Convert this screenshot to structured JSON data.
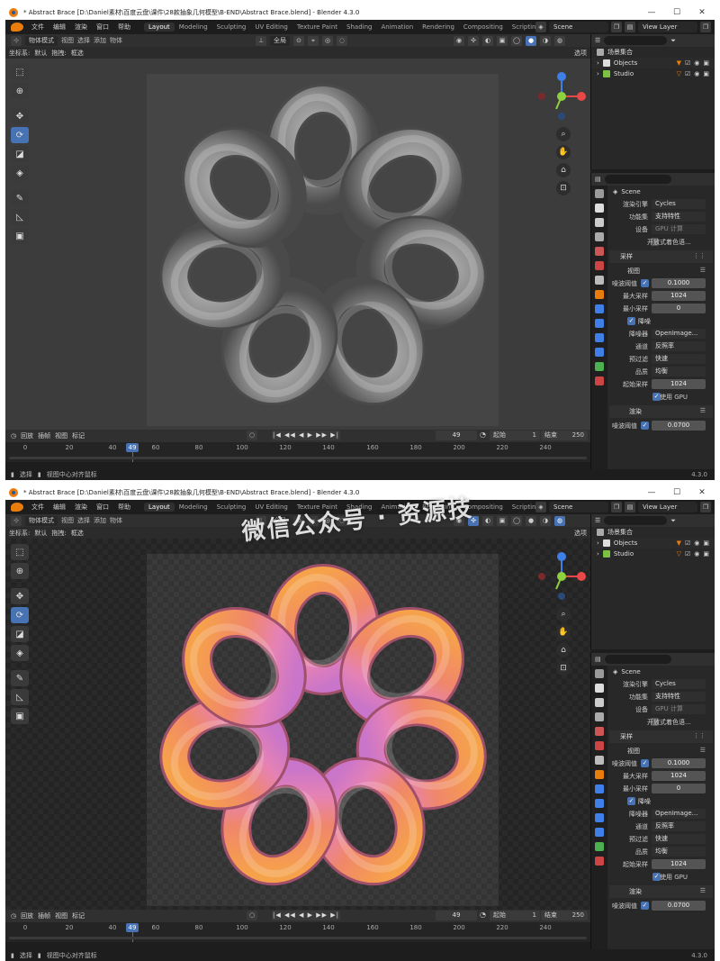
{
  "titlebar": {
    "title": "* Abstract Brace [D:\\Daniel素材\\百度云盘\\课件\\28款抽象几何模型\\B-END\\Abstract Brace.blend] - Blender 4.3.0",
    "min": "—",
    "max": "☐",
    "close": "✕"
  },
  "menu": [
    "文件",
    "编辑",
    "渲染",
    "窗口",
    "帮助"
  ],
  "workspaces": [
    "Layout",
    "Modeling",
    "Sculpting",
    "UV Editing",
    "Texture Paint",
    "Shading",
    "Animation",
    "Rendering",
    "Compositing",
    "Scripting"
  ],
  "scene": "Scene",
  "view_layer": "View Layer",
  "header": {
    "mode": "物体模式",
    "view": "视图",
    "select": "选择",
    "add": "添加",
    "object": "物体",
    "transform": "全局"
  },
  "header2": {
    "orientation_label": "坐标系:",
    "orientation": "默认",
    "drag_label": "拖拽:",
    "drag": "框选",
    "options": "选项"
  },
  "timeline": {
    "playback": "回放",
    "keying": "插帧",
    "view": "视图",
    "marker": "标记",
    "current_frame": "49",
    "start_label": "起始",
    "start": "1",
    "end_label": "结束",
    "end": "250",
    "controls": "|◀ ◀◀ ◀ ▶ ▶▶ ▶|",
    "rec": "○"
  },
  "ruler": {
    "ticks": [
      "0",
      "20",
      "40",
      "60",
      "80",
      "100",
      "120",
      "140",
      "160",
      "180",
      "200",
      "220",
      "240"
    ],
    "current": "49"
  },
  "status": {
    "select": "选择",
    "center": "视图中心对齐鼠标",
    "version": "4.3.0"
  },
  "outliner": {
    "search": "",
    "collection": "场景集合",
    "items": [
      "Objects",
      "Studio"
    ]
  },
  "properties": {
    "scene_label": "Scene",
    "engine_label": "渲染引擎",
    "engine": "Cycles",
    "feature_label": "功能集",
    "feature": "支持特性",
    "device_label": "设备",
    "device": "GPU 计算",
    "osl_label": "开放式着色语...",
    "sampling": "采样",
    "viewport": "视图",
    "noise_thresh_label": "噪波阈值",
    "noise_thresh": "0.1000",
    "max_samples_label": "最大采样",
    "max_samples": "1024",
    "min_samples_label": "最小采样",
    "min_samples": "0",
    "denoise_label": "降噪",
    "denoiser_label": "降噪器",
    "denoiser": "OpenImage...",
    "passes_label": "通道",
    "passes": "反照率",
    "prefilter_label": "预过滤",
    "prefilter": "快速",
    "quality_label": "品质",
    "quality": "均衡",
    "start_sample_label": "起始采样",
    "start_sample": "1024",
    "use_gpu_label": "使用 GPU",
    "render": "渲染",
    "render_thresh_label": "噪波阈值",
    "render_thresh": "0.0700"
  },
  "watermark": "微信公众号 · 资源技",
  "colors": {
    "accent": "#4772b3",
    "orange": "#f08a2a",
    "pink": "#e47fb8",
    "grey": "#8a8a8a"
  }
}
